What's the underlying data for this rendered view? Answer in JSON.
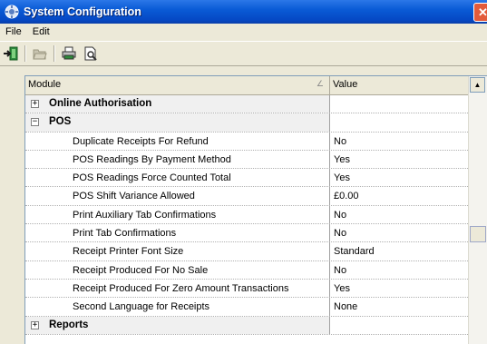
{
  "window": {
    "title": "System Configuration",
    "close_glyph": "✕"
  },
  "menu": {
    "file": "File",
    "edit": "Edit"
  },
  "toolbar": {
    "icons": [
      "exit-icon",
      "folder-open-icon",
      "print-icon",
      "print-preview-icon"
    ]
  },
  "grid": {
    "headers": {
      "module": "Module",
      "value": "Value",
      "sort_glyph": "∠"
    },
    "groups": [
      {
        "label": "Online Authorisation",
        "expander": "+",
        "expanded": false
      },
      {
        "label": "POS",
        "expander": "−",
        "expanded": true
      },
      {
        "label": "Reports",
        "expander": "+",
        "expanded": false
      }
    ],
    "rows": [
      {
        "module": "Duplicate Receipts For Refund",
        "value": "No"
      },
      {
        "module": "POS Readings By Payment Method",
        "value": "Yes"
      },
      {
        "module": "POS Readings Force Counted Total",
        "value": "Yes"
      },
      {
        "module": "POS Shift Variance Allowed",
        "value": "£0.00"
      },
      {
        "module": "Print Auxiliary Tab Confirmations",
        "value": "No"
      },
      {
        "module": "Print Tab Confirmations",
        "value": "No"
      },
      {
        "module": "Receipt Printer Font Size",
        "value": "Standard"
      },
      {
        "module": "Receipt Produced For No Sale",
        "value": "No"
      },
      {
        "module": "Receipt Produced For Zero Amount Transactions",
        "value": "Yes"
      },
      {
        "module": "Second Language for Receipts",
        "value": "None"
      }
    ]
  },
  "scrollbar": {
    "up_glyph": "▲"
  },
  "colors": {
    "title_bar": "#0a5bd6",
    "window_bg": "#ece9d8",
    "close_button": "#e35b3b"
  }
}
